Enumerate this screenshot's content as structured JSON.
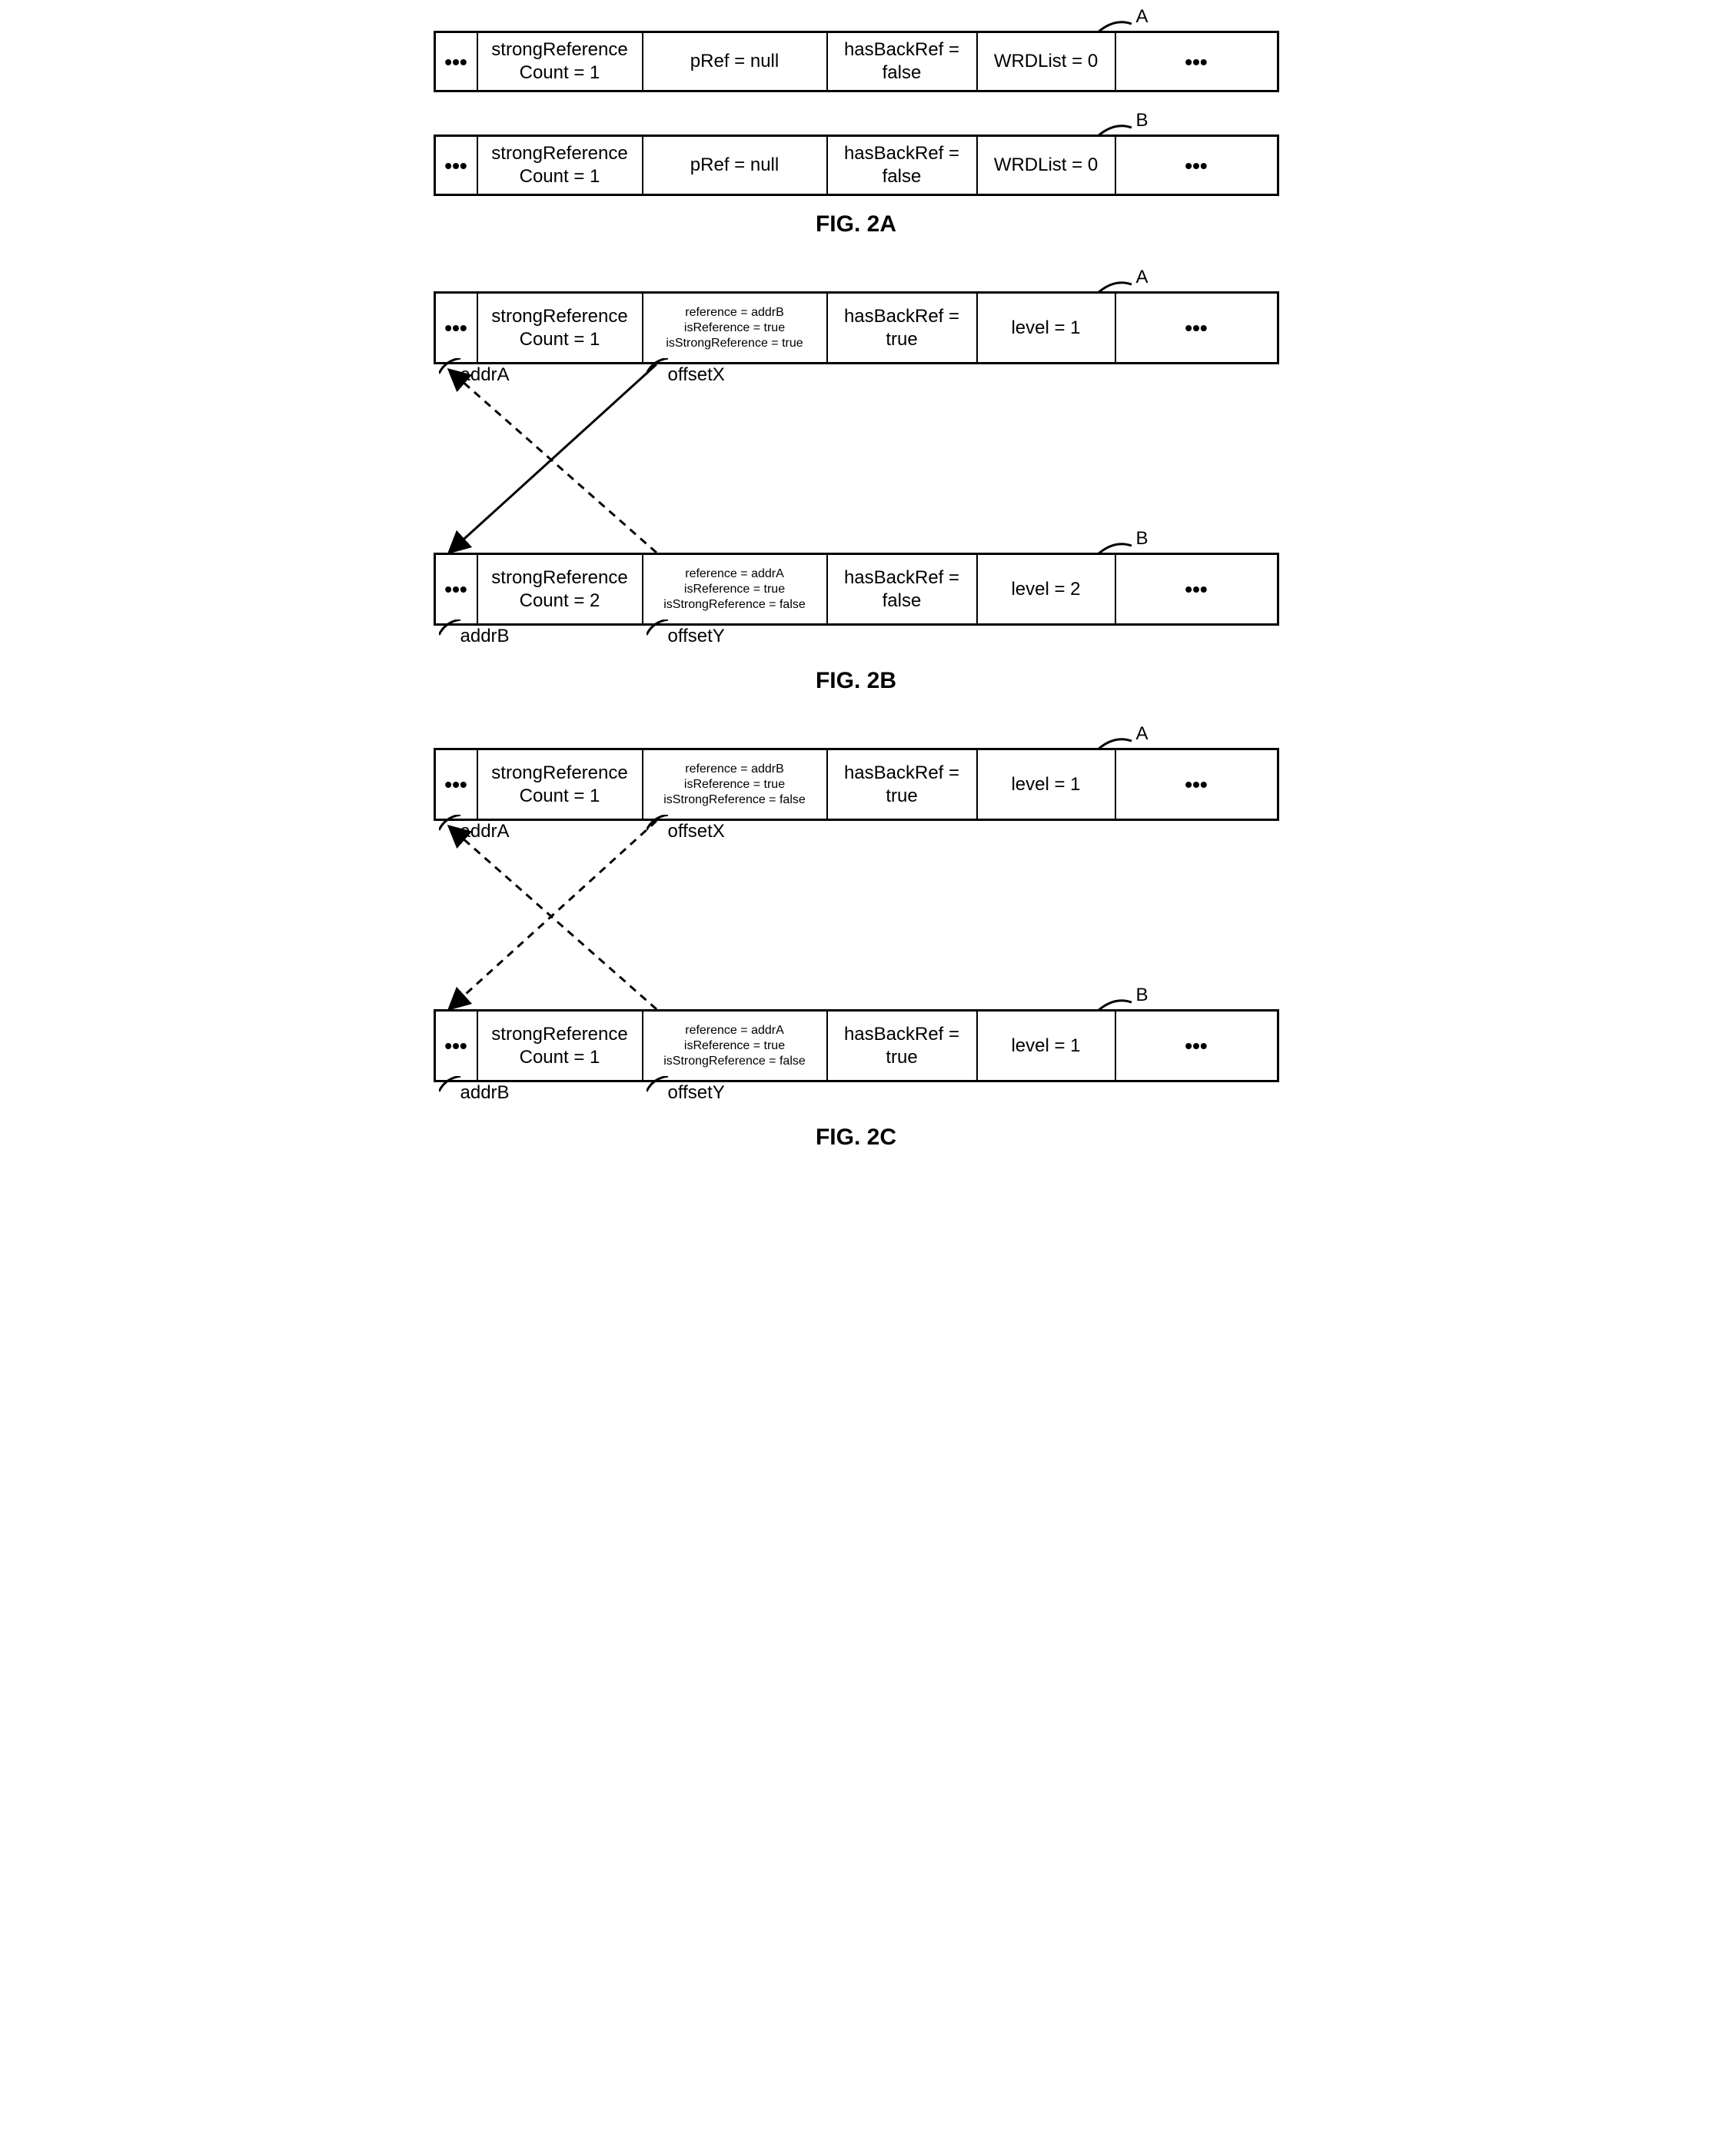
{
  "fig2a": {
    "title": "FIG. 2A",
    "rows": [
      {
        "label": "A",
        "count": "strongReference\nCount = 1",
        "ref": "pRef = null",
        "back": "hasBackRef = false",
        "level": "WRDList = 0"
      },
      {
        "label": "B",
        "count": "strongReference\nCount = 1",
        "ref": "pRef = null",
        "back": "hasBackRef = false",
        "level": "WRDList = 0"
      }
    ]
  },
  "fig2b": {
    "title": "FIG. 2B",
    "rows": [
      {
        "label": "A",
        "addr": "addrA",
        "offset": "offsetX",
        "count": "strongReference\nCount = 1",
        "refLines": [
          "reference = addrB",
          "isReference = true",
          "isStrongReference = true"
        ],
        "back": "hasBackRef = true",
        "level": "level = 1"
      },
      {
        "label": "B",
        "addr": "addrB",
        "offset": "offsetY",
        "count": "strongReference\nCount = 2",
        "refLines": [
          "reference = addrA",
          "isReference = true",
          "isStrongReference = false"
        ],
        "back": "hasBackRef = false",
        "level": "level = 2"
      }
    ]
  },
  "fig2c": {
    "title": "FIG. 2C",
    "rows": [
      {
        "label": "A",
        "addr": "addrA",
        "offset": "offsetX",
        "count": "strongReference\nCount = 1",
        "refLines": [
          "reference = addrB",
          "isReference = true",
          "isStrongReference = false"
        ],
        "back": "hasBackRef = true",
        "level": "level = 1"
      },
      {
        "label": "B",
        "addr": "addrB",
        "offset": "offsetY",
        "count": "strongReference\nCount = 1",
        "refLines": [
          "reference = addrA",
          "isReference = true",
          "isStrongReference = false"
        ],
        "back": "hasBackRef = true",
        "level": "level = 1"
      }
    ]
  }
}
